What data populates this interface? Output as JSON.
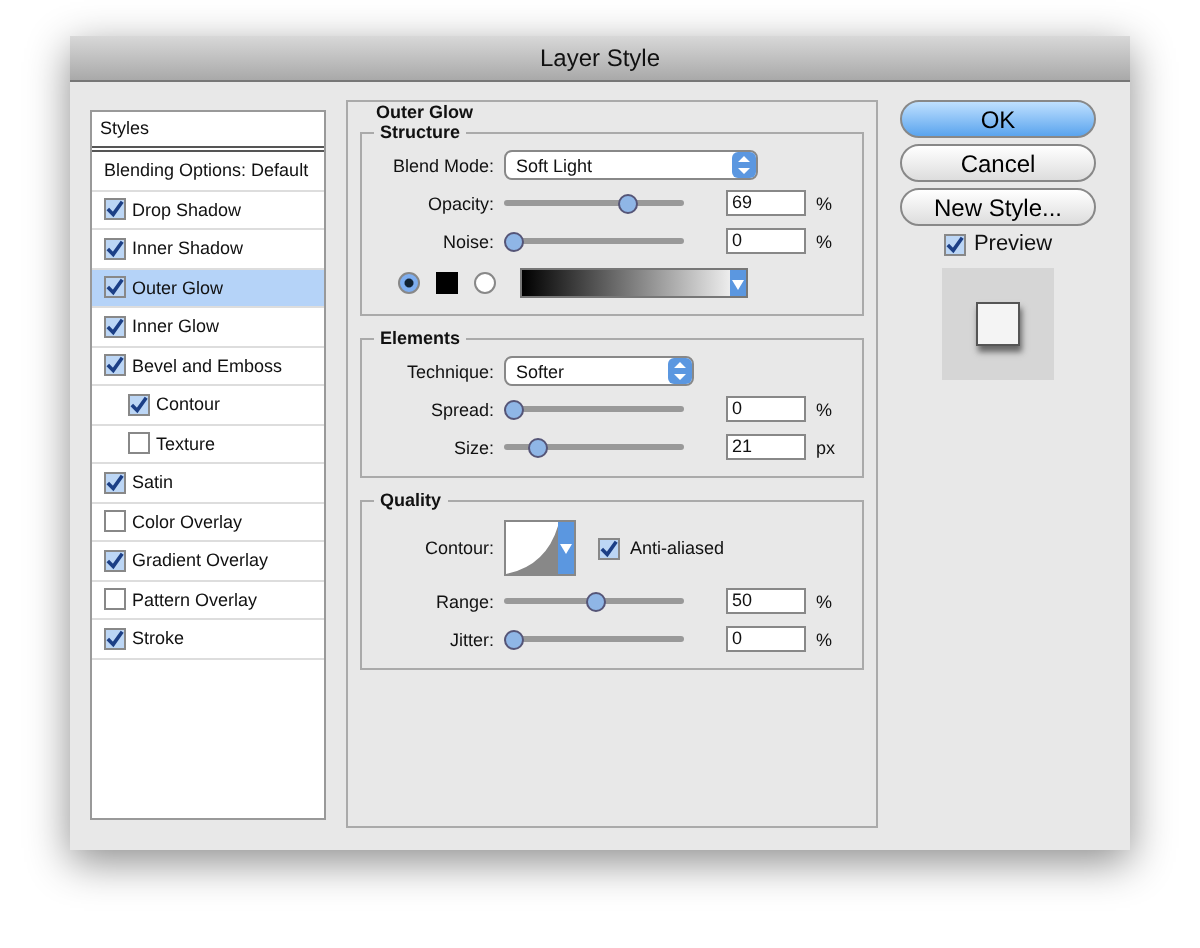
{
  "window": {
    "title": "Layer Style"
  },
  "sidebar": {
    "header": "Styles",
    "items": [
      {
        "label": "Blending Options: Default",
        "kind": "plain",
        "selected": false
      },
      {
        "label": "Drop Shadow",
        "kind": "check",
        "checked": true,
        "selected": false
      },
      {
        "label": "Inner Shadow",
        "kind": "check",
        "checked": true,
        "selected": false
      },
      {
        "label": "Outer Glow",
        "kind": "check",
        "checked": true,
        "selected": true
      },
      {
        "label": "Inner Glow",
        "kind": "check",
        "checked": true,
        "selected": false
      },
      {
        "label": "Bevel and Emboss",
        "kind": "check",
        "checked": true,
        "selected": false,
        "children": [
          {
            "label": "Contour",
            "kind": "check",
            "checked": true,
            "selected": false
          },
          {
            "label": "Texture",
            "kind": "check",
            "checked": false,
            "selected": false
          }
        ]
      },
      {
        "label": "Satin",
        "kind": "check",
        "checked": true,
        "selected": false
      },
      {
        "label": "Color Overlay",
        "kind": "check",
        "checked": false,
        "selected": false
      },
      {
        "label": "Gradient Overlay",
        "kind": "check",
        "checked": true,
        "selected": false
      },
      {
        "label": "Pattern Overlay",
        "kind": "check",
        "checked": false,
        "selected": false
      },
      {
        "label": "Stroke",
        "kind": "check",
        "checked": true,
        "selected": false
      }
    ]
  },
  "panel": {
    "title": "Outer Glow",
    "structure": {
      "title": "Structure",
      "blend_mode": {
        "label": "Blend Mode:",
        "value": "Soft Light"
      },
      "sliders": [
        {
          "label": "Opacity:",
          "level": 0.69,
          "value": "69",
          "unit": "%"
        },
        {
          "label": "Noise:",
          "level": 0,
          "value": "0",
          "unit": "%"
        }
      ],
      "color_options": [
        {
          "kind": "swatch",
          "selected": true
        },
        {
          "kind": "gradient",
          "selected": false
        }
      ]
    },
    "elements": {
      "title": "Elements",
      "technique": {
        "label": "Technique:",
        "value": "Softer"
      },
      "sliders": [
        {
          "label": "Spread:",
          "level": 0,
          "value": "0",
          "unit": "%"
        },
        {
          "label": "Size:",
          "level": 0.15,
          "value": "21",
          "unit": "px"
        }
      ]
    },
    "quality": {
      "title": "Quality",
      "contour": {
        "label": "Contour:"
      },
      "anti_aliased": {
        "label": "Anti-aliased",
        "checked": true
      },
      "sliders": [
        {
          "label": "Range:",
          "level": 0.5,
          "value": "50",
          "unit": "%"
        },
        {
          "label": "Jitter:",
          "level": 0,
          "value": "0",
          "unit": "%"
        }
      ]
    }
  },
  "buttons": [
    {
      "label": "OK",
      "kind": "default"
    },
    {
      "label": "Cancel",
      "kind": "normal"
    },
    {
      "label": "New Style...",
      "kind": "normal"
    }
  ],
  "preview": {
    "label": "Preview",
    "checked": true
  }
}
